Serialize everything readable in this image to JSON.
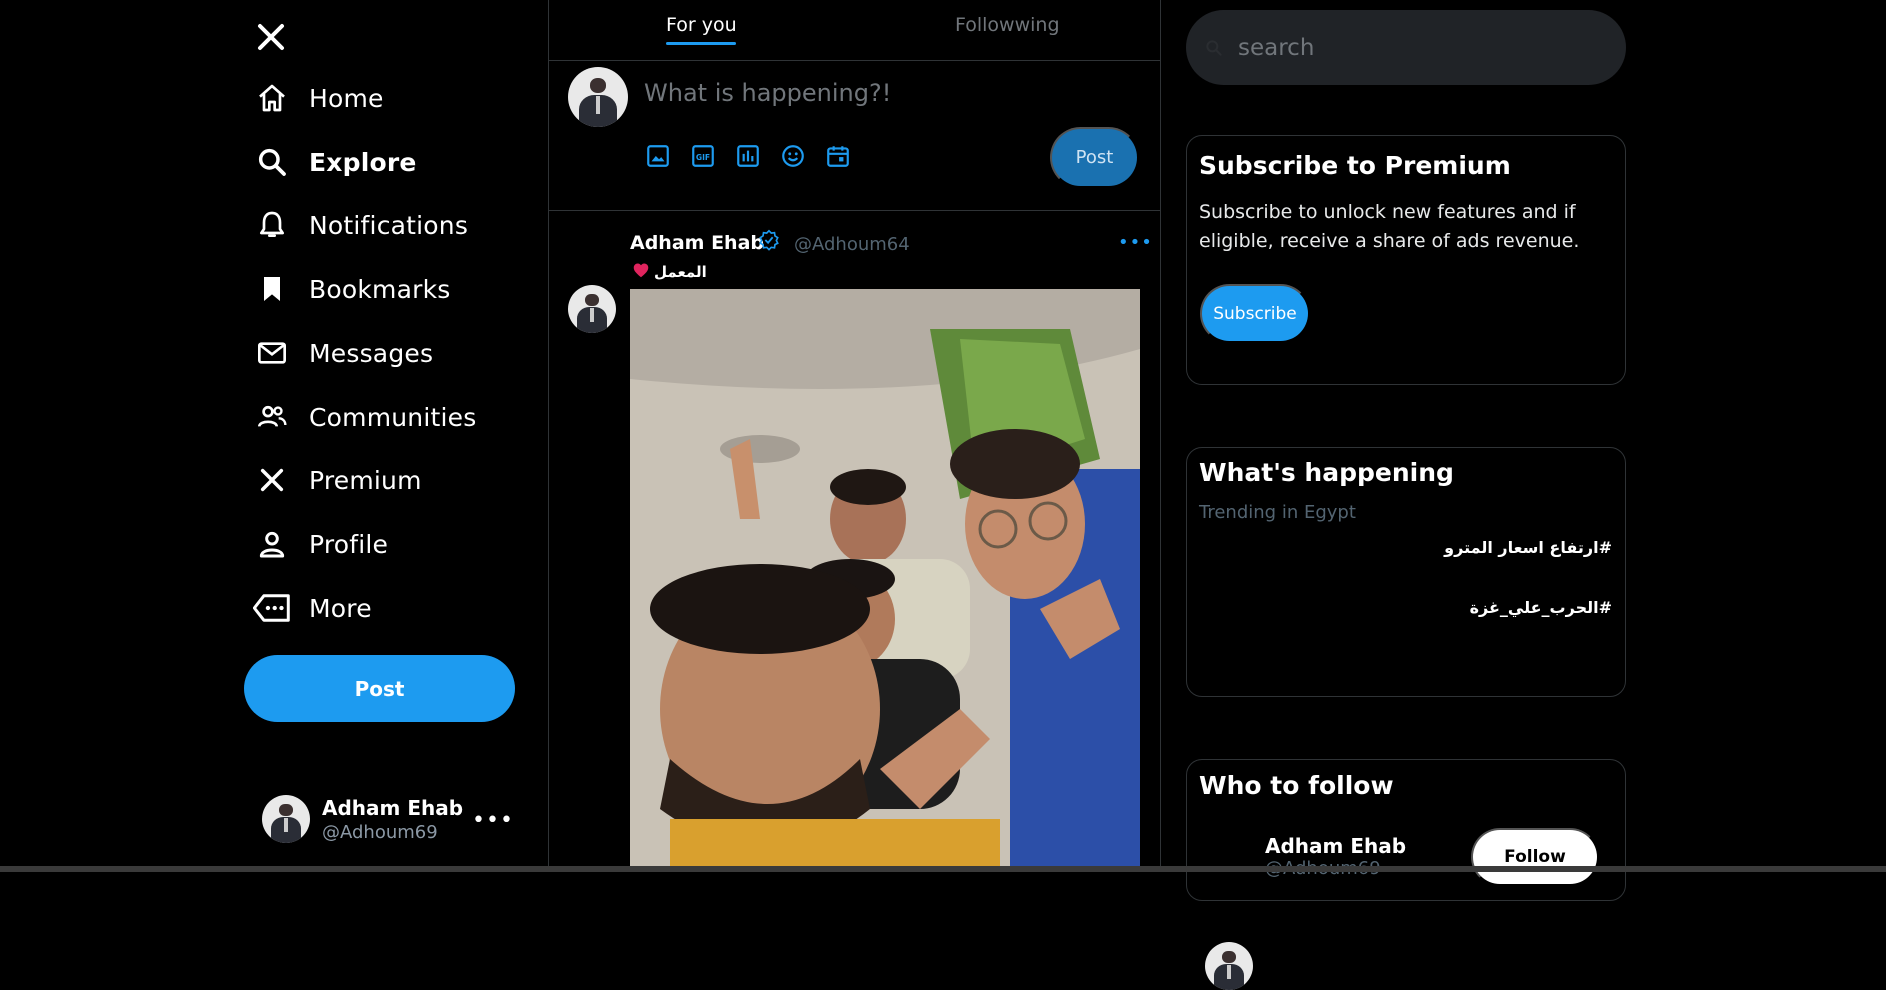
{
  "sidebar": {
    "logo_icon": "x-logo-icon",
    "items": [
      {
        "label": "Home",
        "icon": "home-icon"
      },
      {
        "label": "Explore",
        "icon": "search-icon",
        "active": true
      },
      {
        "label": "Notifications",
        "icon": "bell-icon"
      },
      {
        "label": "Bookmarks",
        "icon": "bookmark-icon"
      },
      {
        "label": "Messages",
        "icon": "mail-icon"
      },
      {
        "label": "Communities",
        "icon": "people-icon"
      },
      {
        "label": "Premium",
        "icon": "x-logo-icon"
      },
      {
        "label": "Profile",
        "icon": "person-icon"
      },
      {
        "label": "More",
        "icon": "more-tag-icon"
      }
    ],
    "post_label": "Post",
    "account": {
      "name": "Adham Ehab",
      "handle": "@Adhoum69",
      "more": "•••"
    }
  },
  "main": {
    "tabs": [
      {
        "label": "For you",
        "active": true
      },
      {
        "label": "Followwing",
        "active": false
      }
    ],
    "compose": {
      "placeholder": "What is happening?!",
      "tools": [
        "image-icon",
        "gif-icon",
        "poll-icon",
        "emoji-icon",
        "schedule-icon"
      ],
      "post_label": "Post"
    },
    "tweet": {
      "name": "Adham Ehab",
      "handle": "@Adhoum64",
      "text": "المعمل",
      "more": "•••"
    }
  },
  "right": {
    "search": {
      "placeholder": "search"
    },
    "premium": {
      "title": "Subscribe to Premium",
      "desc_line1": "Subscribe to unlock new features and if",
      "desc_line2": "eligible, receive a share of ads revenue.",
      "button": "Subscribe"
    },
    "happening": {
      "title": "What's happening",
      "subtitle": "Trending in Egypt",
      "trends": [
        "#ارتفاع اسعار المترو",
        "#الحرب_علي_غزة"
      ]
    },
    "who_to_follow": {
      "title": "Who to follow",
      "user": {
        "name": "Adham Ehab",
        "handle": "@Adhoum69"
      },
      "follow_label": "Follow"
    }
  },
  "colors": {
    "accent": "#1d9bf0",
    "background": "#000000",
    "muted": "#71767b",
    "border": "#2f3336"
  }
}
